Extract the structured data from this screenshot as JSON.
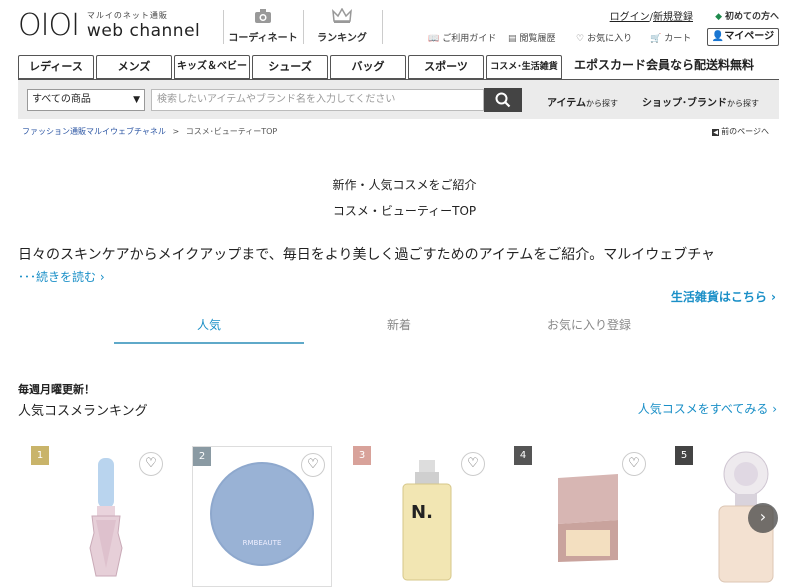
{
  "header": {
    "logo_mark": "OIOI",
    "logo_sub": "マルイのネット通販",
    "logo_main": "web channel",
    "tools": [
      {
        "label": "コーディネート",
        "icon": "camera-icon"
      },
      {
        "label": "ランキング",
        "icon": "crown-icon"
      }
    ],
    "login": "ログイン",
    "slash": "/",
    "register": "新規登録",
    "first_time": "初めての方へ",
    "util": [
      {
        "label": "ご利用ガイド",
        "icon": "book-icon"
      },
      {
        "label": "閲覧履歴",
        "icon": "history-icon"
      },
      {
        "label": "お気に入り",
        "icon": "heart-icon"
      },
      {
        "label": "カート",
        "icon": "cart-icon"
      }
    ],
    "mypage": "マイページ"
  },
  "nav": {
    "items": [
      "レディース",
      "メンズ",
      "キッズ＆ベビー",
      "シューズ",
      "バッグ",
      "スポーツ",
      "コスメ･生活雑貨"
    ],
    "promo": "エポスカード会員なら配送料無料"
  },
  "search": {
    "category": "すべての商品",
    "placeholder": "検索したいアイテムやブランド名を入力してください",
    "item_link": "アイテム",
    "item_link_suffix": "から探す",
    "shop_link": "ショップ･ブランド",
    "shop_link_suffix": "から探す"
  },
  "breadcrumb": {
    "home": "ファッション通販マルイウェブチャネル",
    "sep": ">",
    "current": "コスメ･ビューティーTOP"
  },
  "back_link": "前のページへ",
  "intro": {
    "line1": "新作・人気コスメをご紹介",
    "line2": "コスメ・ビューティーTOP"
  },
  "lead": "日々のスキンケアからメイクアップまで、毎日をより美しく過ごすためのアイテムをご紹介。マルイウェブチャ",
  "read_more": "･･･続きを読む ›",
  "life_goods_link": "生活雑貨はこちら ›",
  "tabs": [
    {
      "label": "人気",
      "active": true
    },
    {
      "label": "新着",
      "active": false
    },
    {
      "label": "お気に入り登録",
      "active": false
    }
  ],
  "ranking": {
    "weekly": "毎週月曜更新！",
    "title": "人気コスメランキング",
    "see_all": "人気コスメをすべてみる ›",
    "items": [
      {
        "rank": "1",
        "badge_color": "#c9b46a"
      },
      {
        "rank": "2",
        "badge_color": "#8a9aa3"
      },
      {
        "rank": "3",
        "badge_color": "#d8a29a"
      },
      {
        "rank": "4",
        "badge_color": "#555555"
      },
      {
        "rank": "5",
        "badge_color": "#444444"
      }
    ],
    "compact_text": "RMBEAUTE",
    "bottle_text": "N."
  },
  "colors": {
    "link_blue": "#1a8fc7",
    "tab_underline": "#5fa9c9",
    "search_bg": "#ebebeb"
  }
}
